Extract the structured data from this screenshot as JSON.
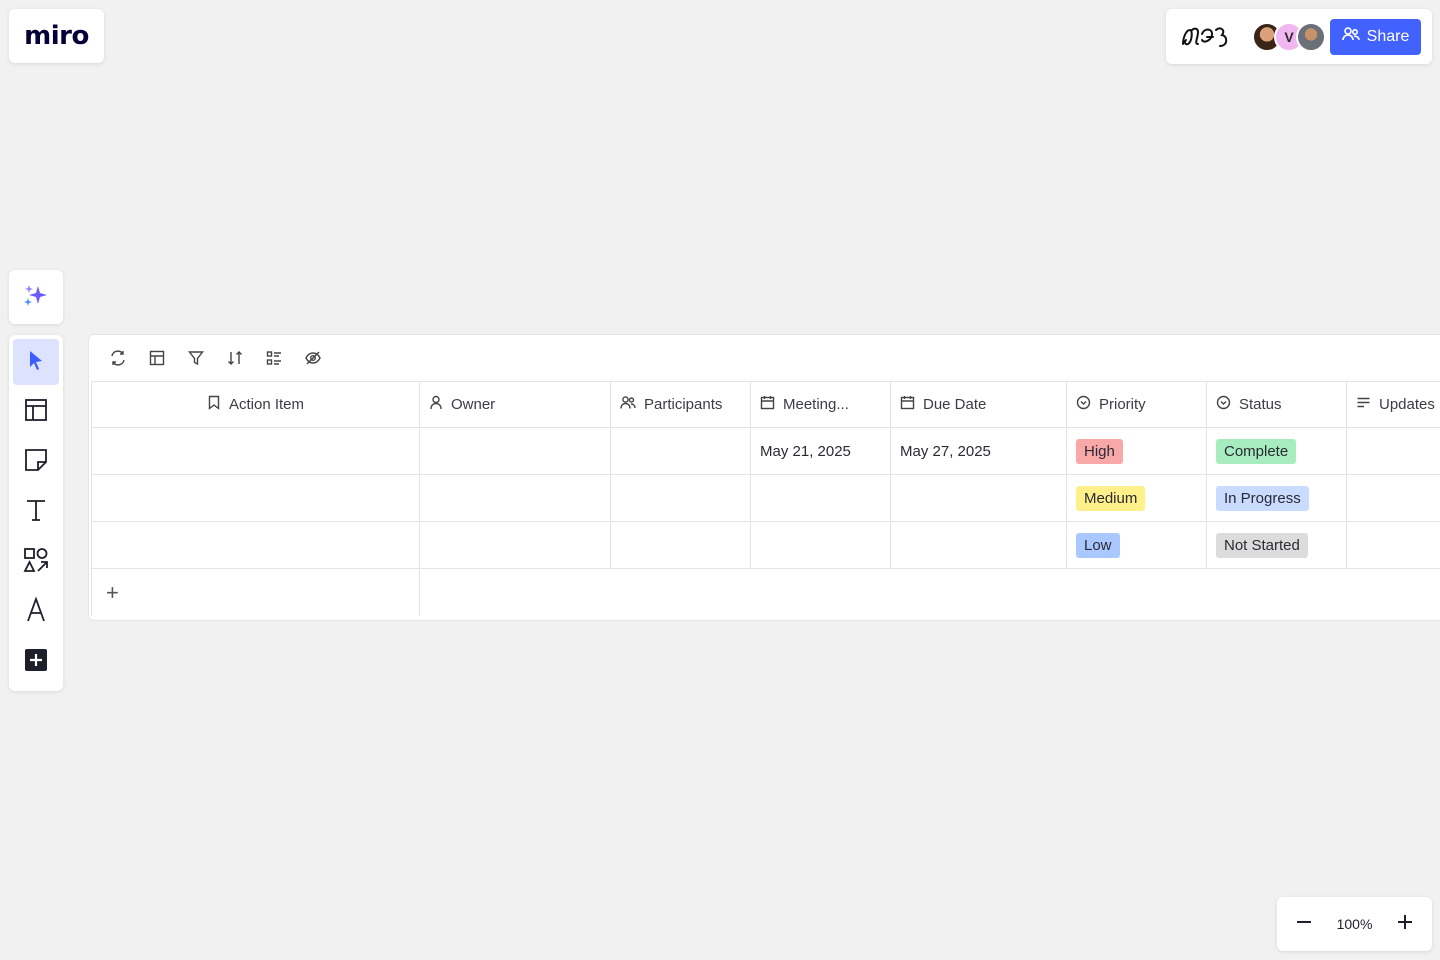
{
  "logo": {
    "text": "miro"
  },
  "header": {
    "avatars": [
      {
        "initial": ""
      },
      {
        "initial": "V"
      },
      {
        "initial": ""
      }
    ],
    "share_label": "Share",
    "accent_color": "#4262ff"
  },
  "toolbar_icons": [
    "sparkle-icon",
    "select-cursor-icon",
    "templates-icon",
    "sticky-note-icon",
    "text-icon",
    "shapes-icon",
    "pen-icon",
    "add-more-icon"
  ],
  "table": {
    "toolbar_icons": [
      "refresh-icon",
      "table-layout-icon",
      "filter-icon",
      "sort-icon",
      "group-icon",
      "hide-fields-icon"
    ],
    "columns": [
      {
        "label": "Action Item",
        "icon": "bookmark-icon"
      },
      {
        "label": "Owner",
        "icon": "user-icon"
      },
      {
        "label": "Participants",
        "icon": "users-icon"
      },
      {
        "label": "Meeting...",
        "icon": "calendar-icon"
      },
      {
        "label": "Due Date",
        "icon": "calendar-icon"
      },
      {
        "label": "Priority",
        "icon": "select-icon"
      },
      {
        "label": "Status",
        "icon": "select-icon"
      },
      {
        "label": "Updates",
        "icon": "text-lines-icon"
      }
    ],
    "rows": [
      {
        "action": "",
        "owner": "",
        "participants": "",
        "meeting": "May 21, 2025",
        "due": "May 27, 2025",
        "priority": {
          "label": "High",
          "color": "#f9a8a8"
        },
        "status": {
          "label": "Complete",
          "color": "#a6ecbf"
        },
        "updates": ""
      },
      {
        "action": "",
        "owner": "",
        "participants": "",
        "meeting": "",
        "due": "",
        "priority": {
          "label": "Medium",
          "color": "#fff08a"
        },
        "status": {
          "label": "In Progress",
          "color": "#c9dcff"
        },
        "updates": ""
      },
      {
        "action": "",
        "owner": "",
        "participants": "",
        "meeting": "",
        "due": "",
        "priority": {
          "label": "Low",
          "color": "#a9c8ff"
        },
        "status": {
          "label": "Not Started",
          "color": "#dcdcdc"
        },
        "updates": ""
      }
    ],
    "add_row_label": "+"
  },
  "zoom": {
    "level": "100%"
  }
}
